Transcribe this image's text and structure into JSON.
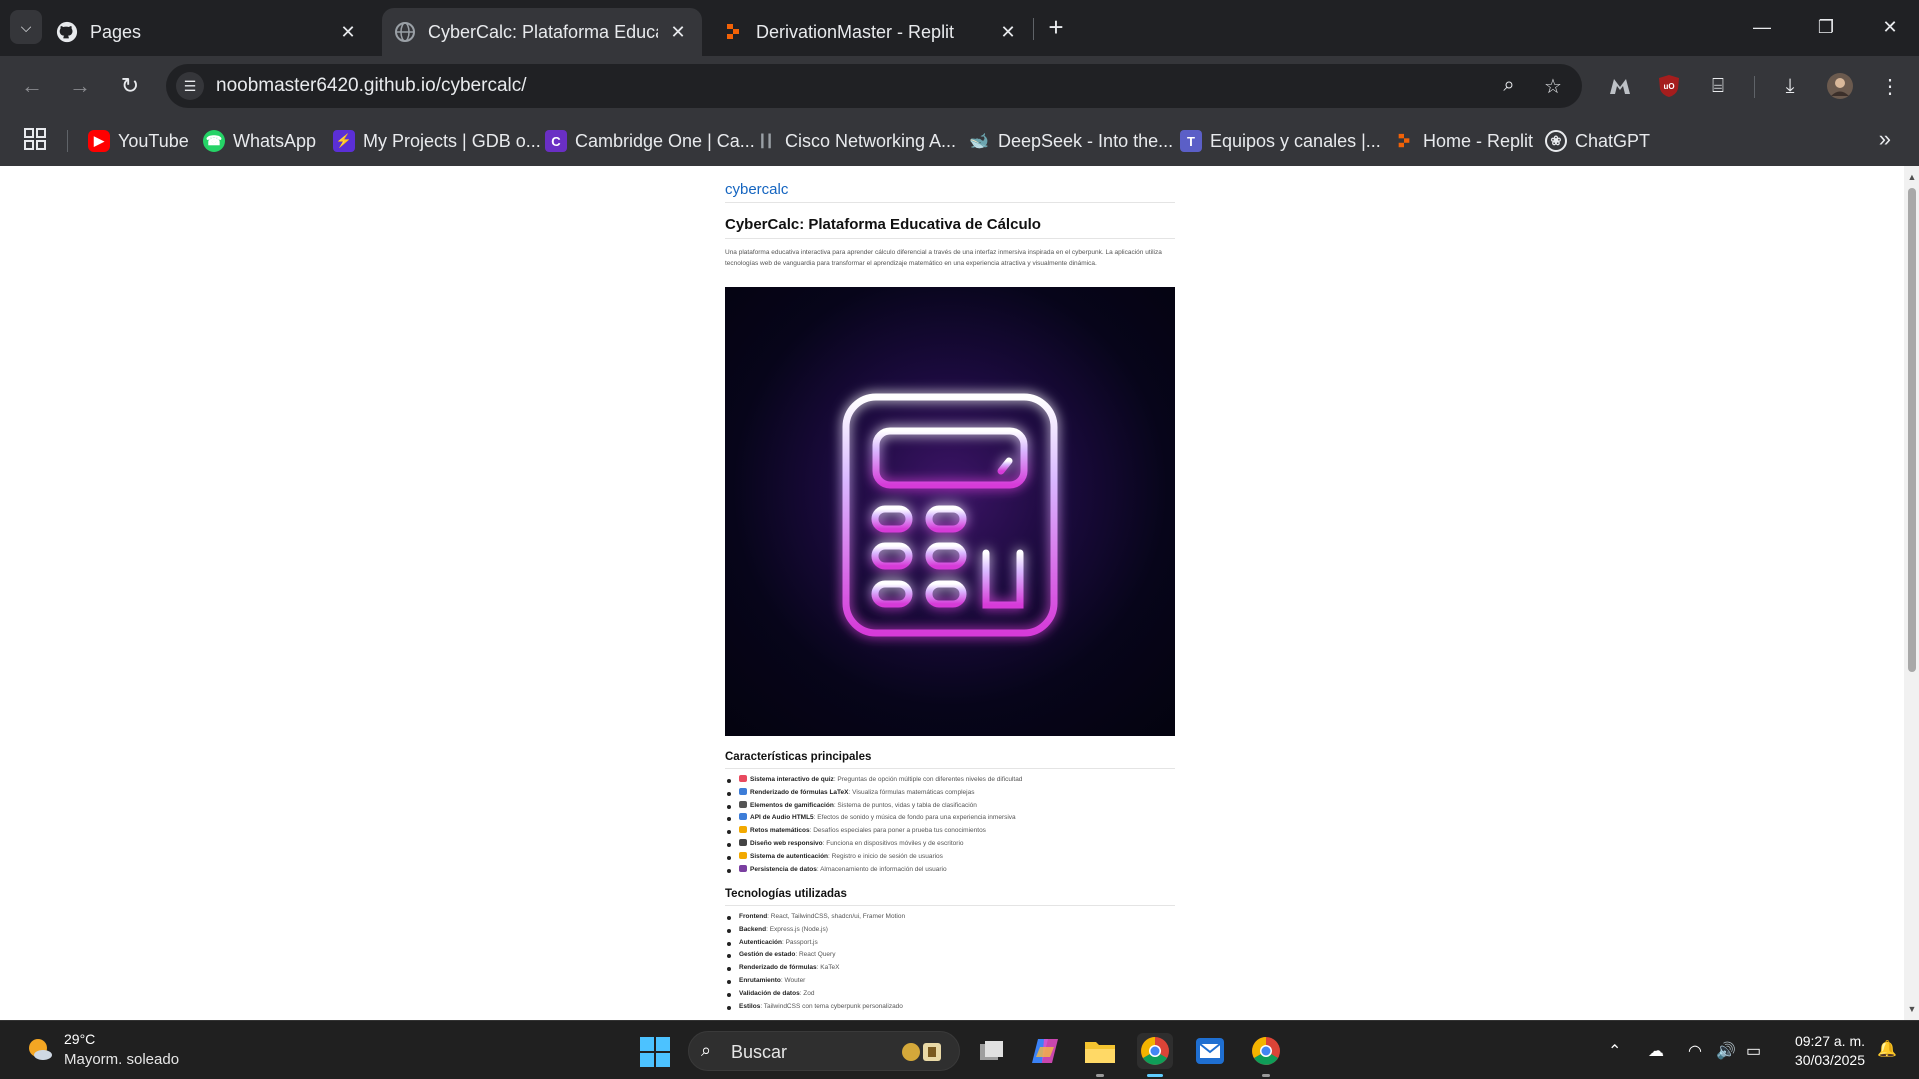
{
  "browser": {
    "tabs": [
      {
        "title": "Pages",
        "icon": "github-icon",
        "active": false
      },
      {
        "title": "CyberCalc: Plataforma Educativa de Cálculo",
        "icon": "globe-icon",
        "active": true
      },
      {
        "title": "DerivationMaster - Replit",
        "icon": "replit-icon",
        "active": false
      }
    ],
    "url": "noobmaster6420.github.io/cybercalc/",
    "bookmarks": [
      {
        "label": "YouTube",
        "icon": "youtube-icon",
        "color": "#ff0000"
      },
      {
        "label": "WhatsApp",
        "icon": "whatsapp-icon",
        "color": "#25d366"
      },
      {
        "label": "My Projects | GDB o...",
        "icon": "gdb-icon",
        "color": "#5b2fd6"
      },
      {
        "label": "Cambridge One | Ca...",
        "icon": "cambridge-icon",
        "color": "#6a2fc4"
      },
      {
        "label": "Cisco Networking A...",
        "icon": "cisco-icon",
        "color": "#9aa0a6"
      },
      {
        "label": "DeepSeek - Into the...",
        "icon": "deepseek-icon",
        "color": "#4d6bfe"
      },
      {
        "label": "Equipos y canales |...",
        "icon": "teams-icon",
        "color": "#5b5fc7"
      },
      {
        "label": "Home - Replit",
        "icon": "replit-icon",
        "color": "#f26207"
      },
      {
        "label": "ChatGPT",
        "icon": "chatgpt-icon",
        "color": "#e8eaed"
      }
    ]
  },
  "page": {
    "site_title": "cybercalc",
    "heading": "CyberCalc: Plataforma Educativa de Cálculo",
    "description": "Una plataforma educativa interactiva para aprender cálculo diferencial a través de una interfaz inmersiva inspirada en el cyberpunk. La aplicación utiliza tecnologías web de vanguardia para transformar el aprendizaje matemático en una experiencia atractiva y visualmente dinámica.",
    "features_heading": "Características principales",
    "features": [
      {
        "bold": "Sistema interactivo de quiz",
        "text": ": Preguntas de opción múltiple con diferentes niveles de dificultad",
        "color": "#e84a5f"
      },
      {
        "bold": "Renderizado de fórmulas LaTeX",
        "text": ": Visualiza fórmulas matemáticas complejas",
        "color": "#3d7dd8"
      },
      {
        "bold": "Elementos de gamificación",
        "text": ": Sistema de puntos, vidas y tabla de clasificación",
        "color": "#555555"
      },
      {
        "bold": "API de Audio HTML5",
        "text": ": Efectos de sonido y música de fondo para una experiencia inmersiva",
        "color": "#3d7dd8"
      },
      {
        "bold": "Retos matemáticos",
        "text": ": Desafíos especiales para poner a prueba tus conocimientos",
        "color": "#f2a900"
      },
      {
        "bold": "Diseño web responsivo",
        "text": ": Funciona en dispositivos móviles y de escritorio",
        "color": "#444444"
      },
      {
        "bold": "Sistema de autenticación",
        "text": ": Registro e inicio de sesión de usuarios",
        "color": "#f2a900"
      },
      {
        "bold": "Persistencia de datos",
        "text": ": Almacenamiento de información del usuario",
        "color": "#7a3fa0"
      }
    ],
    "tech_heading": "Tecnologías utilizadas",
    "technologies": [
      {
        "bold": "Frontend",
        "text": ": React, TailwindCSS, shadcn/ui, Framer Motion"
      },
      {
        "bold": "Backend",
        "text": ": Express.js (Node.js)"
      },
      {
        "bold": "Autenticación",
        "text": ": Passport.js"
      },
      {
        "bold": "Gestión de estado",
        "text": ": React Query"
      },
      {
        "bold": "Renderizado de fórmulas",
        "text": ": KaTeX"
      },
      {
        "bold": "Enrutamiento",
        "text": ": Wouter"
      },
      {
        "bold": "Validación de datos",
        "text": ": Zod"
      },
      {
        "bold": "Estilos",
        "text": ": TailwindCSS con tema cyberpunk personalizado"
      }
    ]
  },
  "taskbar": {
    "temperature": "29°C",
    "condition": "Mayorm. soleado",
    "search_placeholder": "Buscar",
    "time": "09:27 a. m.",
    "date": "30/03/2025"
  }
}
